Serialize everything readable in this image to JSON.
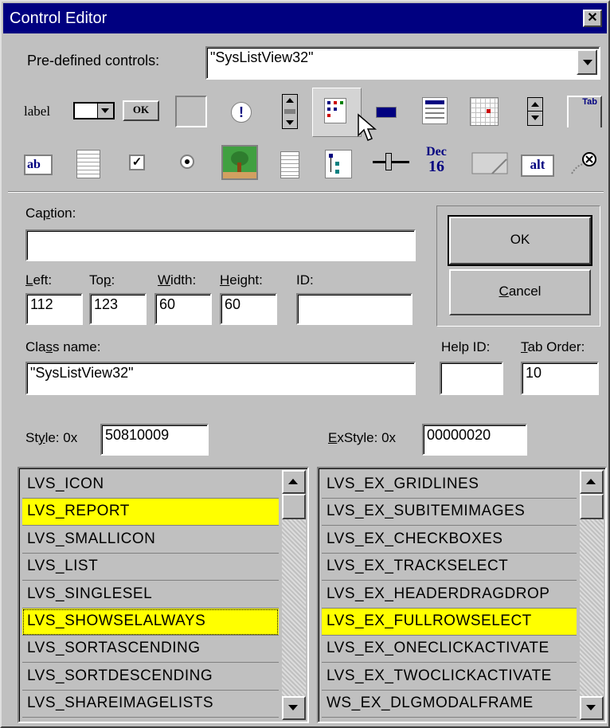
{
  "window": {
    "title": "Control Editor"
  },
  "predefined": {
    "label": "Pre-defined controls:",
    "value": "\"SysListView32\""
  },
  "toolbar_labels": {
    "label_tool": "label",
    "ok_tool": "OK",
    "edit_tool": "ab",
    "dec": "Dec",
    "day": "16",
    "alt": "alt",
    "tab": "Tab"
  },
  "caption": {
    "label_pre": "Ca",
    "label_u": "p",
    "label_post": "tion:",
    "value": ""
  },
  "fields": {
    "left": {
      "label_u": "L",
      "label_post": "eft:",
      "value": "112"
    },
    "top": {
      "label_pre": "To",
      "label_u": "p",
      "label_post": ":",
      "value": "123"
    },
    "width": {
      "label_u": "W",
      "label_post": "idth:",
      "value": "60"
    },
    "height": {
      "label_u": "H",
      "label_post": "eight:",
      "value": "60"
    },
    "id": {
      "label": "ID:",
      "value": ""
    }
  },
  "classname": {
    "label_pre": "Cla",
    "label_u": "s",
    "label_post": "s name:",
    "value": "\"SysListView32\""
  },
  "helpid": {
    "label": "Help ID:",
    "value": ""
  },
  "taborder": {
    "label_u": "T",
    "label_post": "ab Order:",
    "value": "10"
  },
  "buttons": {
    "ok": "OK",
    "cancel_u": "C",
    "cancel_post": "ancel"
  },
  "style": {
    "label_pre": "St",
    "label_u": "y",
    "label_post": "le:  0x",
    "value": "50810009"
  },
  "exstyle": {
    "label_u": "E",
    "label_post": "xStyle:  0x",
    "value": "00000020"
  },
  "style_list": [
    {
      "text": "LVS_ICON",
      "selected": false
    },
    {
      "text": "LVS_REPORT",
      "selected": true
    },
    {
      "text": "LVS_SMALLICON",
      "selected": false
    },
    {
      "text": "LVS_LIST",
      "selected": false
    },
    {
      "text": "LVS_SINGLESEL",
      "selected": false
    },
    {
      "text": "LVS_SHOWSELALWAYS",
      "selected": true,
      "focused": true
    },
    {
      "text": "LVS_SORTASCENDING",
      "selected": false
    },
    {
      "text": "LVS_SORTDESCENDING",
      "selected": false
    },
    {
      "text": "LVS_SHAREIMAGELISTS",
      "selected": false
    }
  ],
  "exstyle_list": [
    {
      "text": "LVS_EX_GRIDLINES",
      "selected": false
    },
    {
      "text": "LVS_EX_SUBITEMIMAGES",
      "selected": false
    },
    {
      "text": "LVS_EX_CHECKBOXES",
      "selected": false
    },
    {
      "text": "LVS_EX_TRACKSELECT",
      "selected": false
    },
    {
      "text": "LVS_EX_HEADERDRAGDROP",
      "selected": false
    },
    {
      "text": "LVS_EX_FULLROWSELECT",
      "selected": true
    },
    {
      "text": "LVS_EX_ONECLICKACTIVATE",
      "selected": false
    },
    {
      "text": "LVS_EX_TWOCLICKACTIVATE",
      "selected": false
    },
    {
      "text": "WS_EX_DLGMODALFRAME",
      "selected": false
    }
  ],
  "colors": {
    "title_bar": "#000080",
    "face": "#c0c0c0",
    "selected_row": "#ffff00"
  }
}
